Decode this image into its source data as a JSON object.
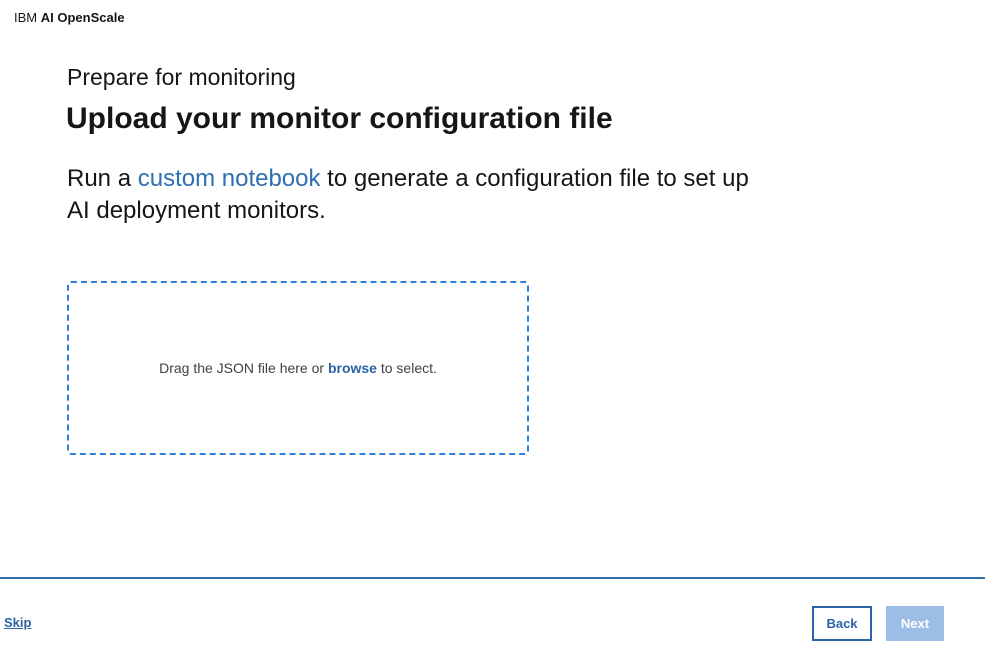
{
  "header": {
    "brand_prefix": "IBM",
    "brand_product": "AI OpenScale"
  },
  "main": {
    "eyebrow": "Prepare for monitoring",
    "title": "Upload your monitor configuration file",
    "description_before": "Run a ",
    "description_link": "custom notebook",
    "description_after": " to generate a configuration file to set up AI deployment monitors."
  },
  "dropzone": {
    "text_before": "Drag the JSON file here or ",
    "browse_label": "browse",
    "text_after": " to select."
  },
  "footer": {
    "skip_label": "Skip",
    "back_label": "Back",
    "next_label": "Next"
  },
  "colors": {
    "accent": "#2b63a8",
    "link": "#2f6fb0",
    "dropzone_border": "#2e7fe0",
    "divider": "#2d6db0",
    "next_disabled_bg": "#9cbde6"
  }
}
